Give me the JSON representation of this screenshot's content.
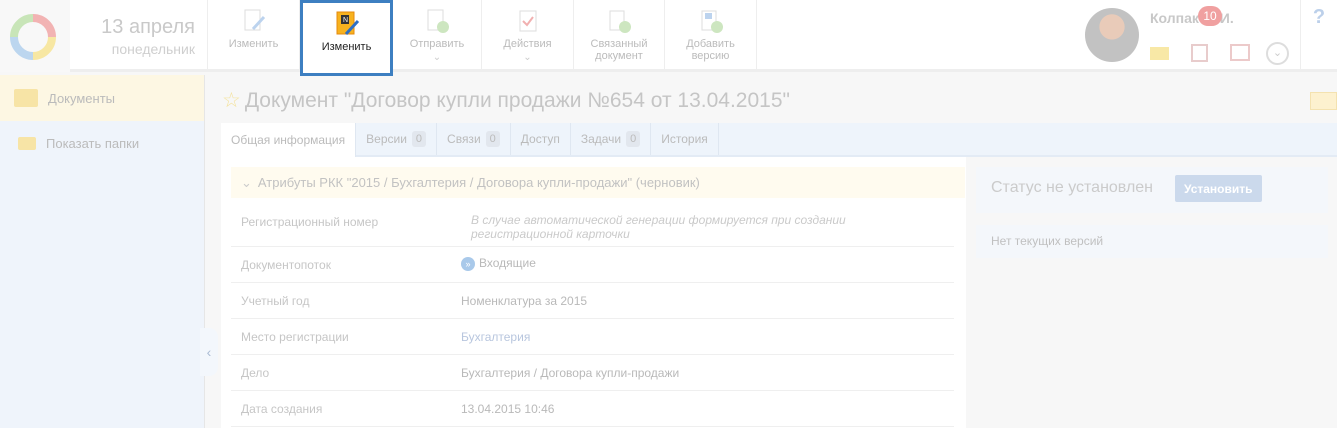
{
  "header": {
    "date": "13 апреля",
    "weekday": "понедельник"
  },
  "toolbar": [
    {
      "label": "Изменить"
    },
    {
      "label": "Изменить",
      "active": true
    },
    {
      "label": "Отправить",
      "dropdown": true
    },
    {
      "label": "Действия",
      "dropdown": true
    },
    {
      "label": "Связанный документ"
    },
    {
      "label": "Добавить версию"
    }
  ],
  "user": {
    "name": "Колпаков И.",
    "task_count": "10",
    "help": "?"
  },
  "sidebar": {
    "items": [
      {
        "label": "Документы"
      },
      {
        "label": "Показать папки"
      }
    ]
  },
  "document": {
    "title": "Документ \"Договор купли продажи №654 от 13.04.2015\""
  },
  "tabs": [
    {
      "label": "Общая информация"
    },
    {
      "label": "Версии",
      "count": "0"
    },
    {
      "label": "Связи",
      "count": "0"
    },
    {
      "label": "Доступ"
    },
    {
      "label": "Задачи",
      "count": "0"
    },
    {
      "label": "История"
    }
  ],
  "attributes": {
    "header": "Атрибуты РКК \"2015 / Бухгалтерия / Договора купли-продажи\" (черновик)",
    "rows": [
      {
        "label": "Регистрационный номер",
        "value": "В случае автоматической генерации формируется при создании регистрационной карточки"
      },
      {
        "label": "Документопоток",
        "value": "Входящие"
      },
      {
        "label": "Учетный год",
        "value": "Номенклатура за 2015"
      },
      {
        "label": "Место регистрации",
        "value": "Бухгалтерия"
      },
      {
        "label": "Дело",
        "value": "Бухгалтерия / Договора купли-продажи"
      },
      {
        "label": "Дата создания",
        "value": "13.04.2015 10:46"
      }
    ]
  },
  "status": {
    "text": "Статус не установлен",
    "button": "Установить"
  },
  "versions": {
    "text": "Нет текущих версий"
  }
}
